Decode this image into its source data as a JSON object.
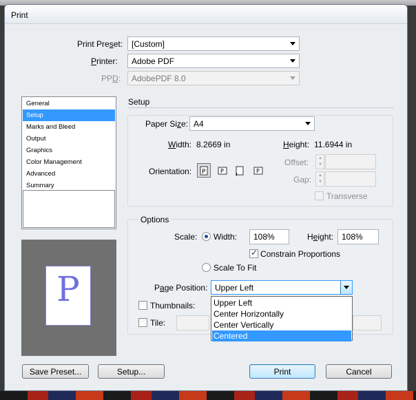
{
  "window": {
    "title": "Print"
  },
  "top": {
    "preset_label": "Print Preset:",
    "preset_value": "[Custom]",
    "printer_label": "Printer:",
    "printer_value": "Adobe PDF",
    "ppd_label": "PPD:",
    "ppd_value": "AdobePDF 8.0"
  },
  "categories": [
    "General",
    "Setup",
    "Marks and Bleed",
    "Output",
    "Graphics",
    "Color Management",
    "Advanced",
    "Summary"
  ],
  "selected_category": "Setup",
  "preview": {
    "glyph": "P"
  },
  "setup": {
    "section_title": "Setup",
    "paper_size_label": "Paper Size:",
    "paper_size_value": "A4",
    "width_label": "Width:",
    "width_value": "8.2669 in",
    "height_label": "Height:",
    "height_value": "11.6944 in",
    "orientation_label": "Orientation:",
    "offset_label": "Offset:",
    "gap_label": "Gap:",
    "transverse_label": "Transverse"
  },
  "options": {
    "section_title": "Options",
    "scale_label": "Scale:",
    "width_radio_label": "Width:",
    "width_value": "108%",
    "height_label": "Height:",
    "height_value": "108%",
    "constrain_label": "Constrain Proportions",
    "constrain_checked": true,
    "scale_to_fit_label": "Scale To Fit",
    "page_position_label": "Page Position:",
    "page_position_value": "Upper Left",
    "page_position_options": [
      "Upper Left",
      "Center Horizontally",
      "Center Vertically",
      "Centered"
    ],
    "page_position_highlighted": "Centered",
    "thumbnails_label": "Thumbnails:",
    "tile_label": "Tile:"
  },
  "buttons": {
    "save_preset": "Save Preset...",
    "setup": "Setup...",
    "print": "Print",
    "cancel": "Cancel"
  },
  "colors": {
    "selection": "#3399ff",
    "preview_glyph": "#6f6fe0"
  }
}
